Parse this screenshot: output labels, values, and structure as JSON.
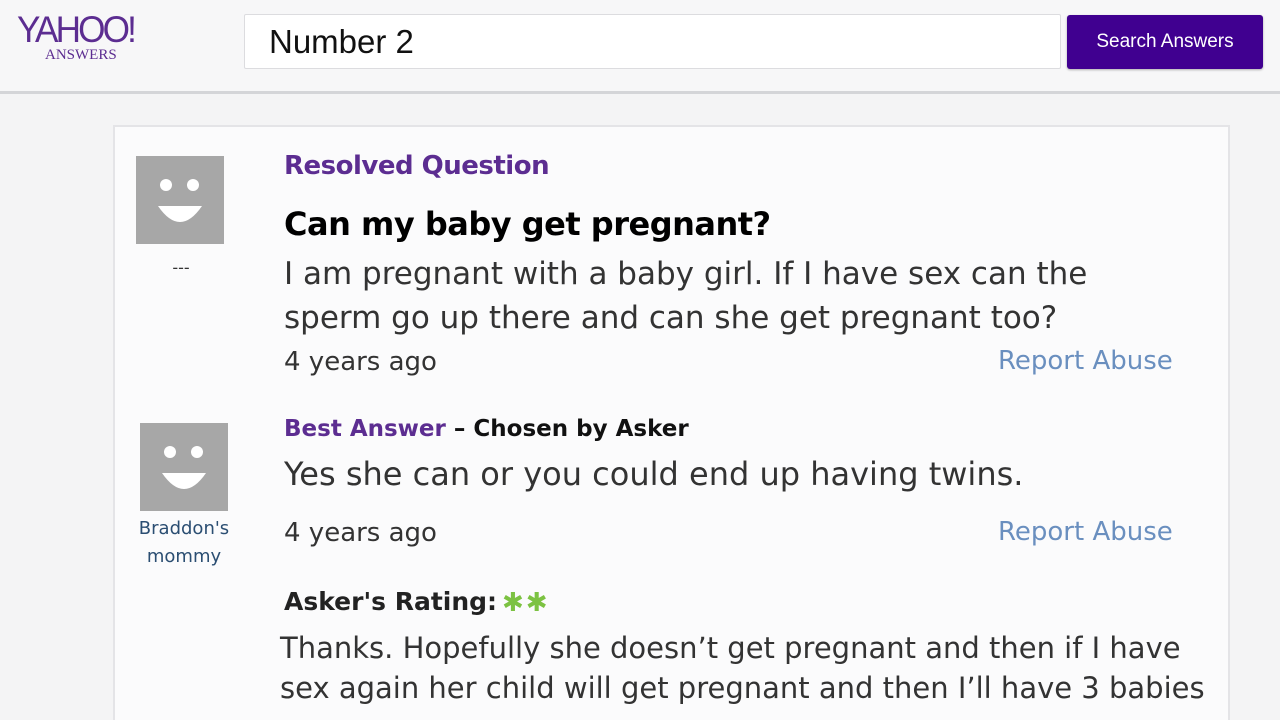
{
  "header": {
    "logo_main": "YAHOO!",
    "logo_sub": "ANSWERS",
    "search_value": "Number 2",
    "search_button": "Search Answers"
  },
  "question": {
    "asker_name": "---",
    "status": "Resolved Question",
    "title": "Can my baby get pregnant?",
    "body": "I am pregnant with a baby girl. If I have sex can the sperm go up there and can she get pregnant too?",
    "time": "4 years ago",
    "report": "Report Abuse"
  },
  "best_answer": {
    "answerer_name": "Braddon's mommy",
    "label": "Best Answer",
    "chosen": " – Chosen by Asker",
    "text": "Yes she can or you could end up having twins.",
    "time": "4 years ago",
    "report": "Report Abuse"
  },
  "rating": {
    "label": "Asker's Rating:",
    "stars_glyphs": "✱✱",
    "stars_count": 2,
    "comment": "Thanks. Hopefully she doesn’t get pregnant and then if I have sex again her child will get pregnant and then I’ll have 3 babies"
  },
  "colors": {
    "brand_purple": "#5c2d91",
    "button_purple": "#400090",
    "link_blue": "#6a8fbf",
    "star_green": "#7cc242"
  }
}
